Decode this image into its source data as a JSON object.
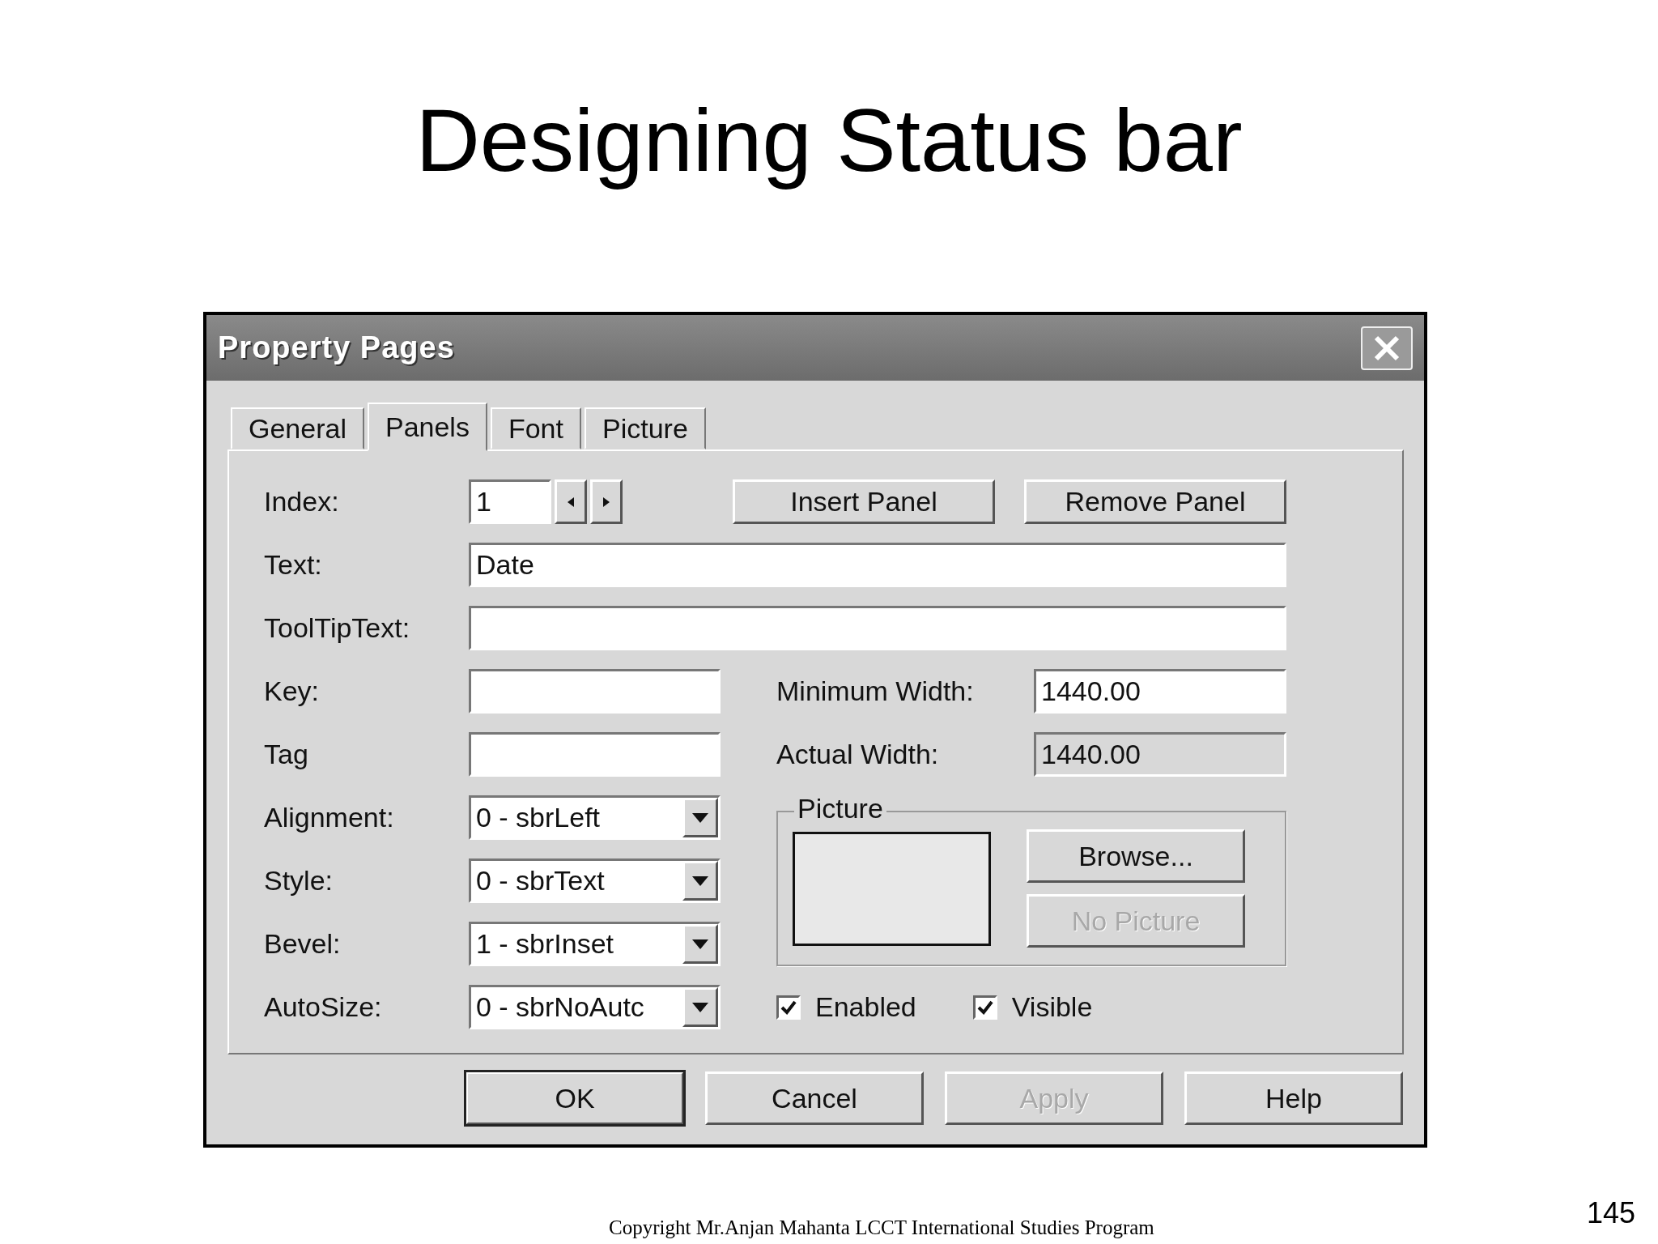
{
  "slide": {
    "title": "Designing Status bar",
    "footer": "Copyright Mr.Anjan Mahanta LCCT International Studies Program",
    "page_number": "145"
  },
  "dialog": {
    "title": "Property Pages",
    "tabs": [
      {
        "label": "General",
        "selected": false
      },
      {
        "label": "Panels",
        "selected": true
      },
      {
        "label": "Font",
        "selected": false
      },
      {
        "label": "Picture",
        "selected": false
      }
    ],
    "index": {
      "label": "Index:",
      "value": "1"
    },
    "panel_buttons": [
      {
        "label": "Insert Panel",
        "disabled": false
      },
      {
        "label": "Remove Panel",
        "disabled": false
      }
    ],
    "wide_fields": [
      {
        "label": "Text:",
        "value": "Date"
      },
      {
        "label": "ToolTipText:"
      }
    ],
    "pair_rows": [
      {
        "left": {
          "label": "Key:"
        },
        "right": {
          "label": "Minimum Width:",
          "value": "1440.00",
          "disabled": false
        }
      },
      {
        "left": {
          "label": "Tag"
        },
        "right": {
          "label": "Actual Width:",
          "value": "1440.00",
          "disabled": true
        }
      }
    ],
    "dropdowns": [
      {
        "label": "Alignment:",
        "value": "0 - sbrLeft"
      },
      {
        "label": "Style:",
        "value": "0 - sbrText"
      },
      {
        "label": "Bevel:",
        "value": "1 - sbrInset"
      },
      {
        "label": "AutoSize:",
        "value": "0 - sbrNoAutc"
      }
    ],
    "picture_group": {
      "title": "Picture",
      "buttons": [
        {
          "label": "Browse...",
          "disabled": false
        },
        {
          "label": "No Picture",
          "disabled": true
        }
      ]
    },
    "checkboxes": [
      {
        "label": "Enabled",
        "checked": true
      },
      {
        "label": "Visible",
        "checked": true
      }
    ],
    "buttons": [
      {
        "label": "OK",
        "default": true,
        "disabled": false
      },
      {
        "label": "Cancel",
        "default": false,
        "disabled": false
      },
      {
        "label": "Apply",
        "default": false,
        "disabled": true
      },
      {
        "label": "Help",
        "default": false,
        "disabled": false
      }
    ]
  }
}
